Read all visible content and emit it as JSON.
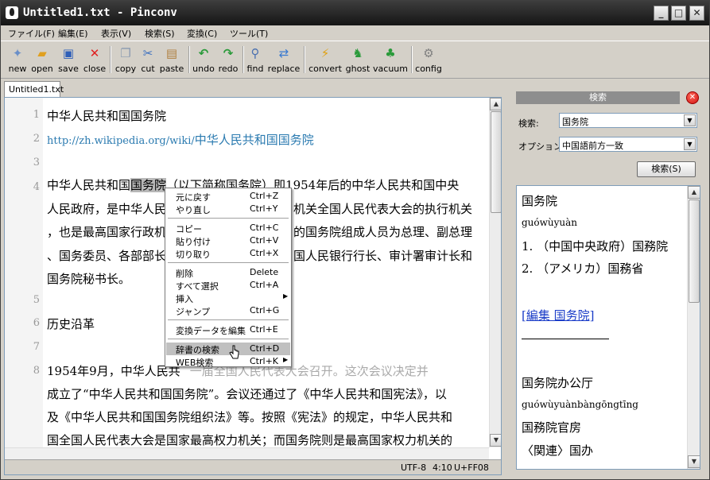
{
  "window": {
    "title": "Untitled1.txt - Pinconv",
    "controls": {
      "minimize": "_",
      "maximize": "□",
      "close": "✕"
    }
  },
  "menubar": [
    "ファイル(F)",
    "編集(E)",
    "表示(V)",
    "検索(S)",
    "変換(C)",
    "ツール(T)"
  ],
  "toolbar": {
    "new": {
      "label": "new",
      "icon": "new-file-icon"
    },
    "open": {
      "label": "open",
      "icon": "folder-open-icon"
    },
    "save": {
      "label": "save",
      "icon": "floppy-disk-icon"
    },
    "close": {
      "label": "close",
      "icon": "red-x-icon"
    },
    "copy": {
      "label": "copy",
      "icon": "copy-icon"
    },
    "cut": {
      "label": "cut",
      "icon": "scissors-icon"
    },
    "paste": {
      "label": "paste",
      "icon": "clipboard-icon"
    },
    "undo": {
      "label": "undo",
      "icon": "undo-arrow-icon"
    },
    "redo": {
      "label": "redo",
      "icon": "redo-arrow-icon"
    },
    "find": {
      "label": "find",
      "icon": "magnifier-icon"
    },
    "replace": {
      "label": "replace",
      "icon": "replace-icon"
    },
    "convert": {
      "label": "convert",
      "icon": "lightning-icon"
    },
    "ghost": {
      "label": "ghost",
      "icon": "ghost-icon"
    },
    "vacuum": {
      "label": "vacuum",
      "icon": "vacuum-icon"
    },
    "config": {
      "label": "config",
      "icon": "gear-icon"
    }
  },
  "tab": {
    "label": "Untitled1.txt"
  },
  "editor": {
    "line_numbers": [
      "1",
      "2",
      "3",
      "4",
      "5",
      "6",
      "7",
      "8"
    ],
    "lines": {
      "l1": "中华人民共和国国务院",
      "l2_url": "http://zh.wikipedia.org/wiki/",
      "l2_name": "中华人民共和国国务院",
      "l4_a": "中华人民共和国",
      "l4_sel": "国务院",
      "l4_b": "（以下简称国务院）即1954年后的中华人民共和国中央",
      "l4_c": "人民政府，是中华人民",
      "l4_d": "机关全国人民代表大会的执行机关",
      "l4_e": "，也是最高国家行政机",
      "l4_f": "的国务院组成人员为总理、副总理",
      "l4_g": "、国务委员、各部部长",
      "l4_h": "国人民银行行长、审计署审计长和",
      "l4_i": "国务院秘书长。",
      "l6": "历史沿革",
      "l8_a": "1954年9月，中华人民共",
      "l8_b": "一届全国人民代表大会召开。这次会议决定并",
      "l8_c": "成立了“中华人民共和国国务院”。会议还通过了《中华人民共和国宪法》，以",
      "l8_d": "及《中华人民共和国国务院组织法》等。按照《宪法》的规定，中华人民共和",
      "l8_e": "国全国人民代表大会是国家最高权力机关；而国务院则是最高国家权力机关的"
    }
  },
  "status": {
    "encoding": "UTF-8",
    "position": "4:10",
    "code": "U+FF08"
  },
  "context_menu": {
    "undo": {
      "label": "元に戻す",
      "shortcut": "Ctrl+Z"
    },
    "redo": {
      "label": "やり直し",
      "shortcut": "Ctrl+Y"
    },
    "copy": {
      "label": "コピー",
      "shortcut": "Ctrl+C"
    },
    "paste": {
      "label": "貼り付け",
      "shortcut": "Ctrl+V"
    },
    "cut": {
      "label": "切り取り",
      "shortcut": "Ctrl+X"
    },
    "delete": {
      "label": "削除",
      "shortcut": "Delete"
    },
    "select_all": {
      "label": "すべて選択",
      "shortcut": "Ctrl+A"
    },
    "insert": {
      "label": "挿入"
    },
    "jump": {
      "label": "ジャンプ",
      "shortcut": "Ctrl+G"
    },
    "edit_conv": {
      "label": "変換データを編集",
      "shortcut": "Ctrl+E"
    },
    "dict_search": {
      "label": "辞書の検索",
      "shortcut": "Ctrl+D"
    },
    "web_search": {
      "label": "WEB検索",
      "shortcut": "Ctrl+K"
    }
  },
  "panel": {
    "title": "検索",
    "search_label": "検索:",
    "search_value": "国务院",
    "option_label": "オプション:",
    "option_value": "中国語前方一致",
    "search_button": "検索(S)",
    "result": {
      "r1": "国务院",
      "r2": "guówùyuàn",
      "r3": "1. （中国中央政府）国務院",
      "r4": "2. （アメリカ）国務省",
      "r5": "[編集 国务院]",
      "r6": "国务院办公厅",
      "r7": "guówùyuànbàngōngtīng",
      "r8": "国務院官房",
      "r9": "〈関連〉国办"
    }
  }
}
